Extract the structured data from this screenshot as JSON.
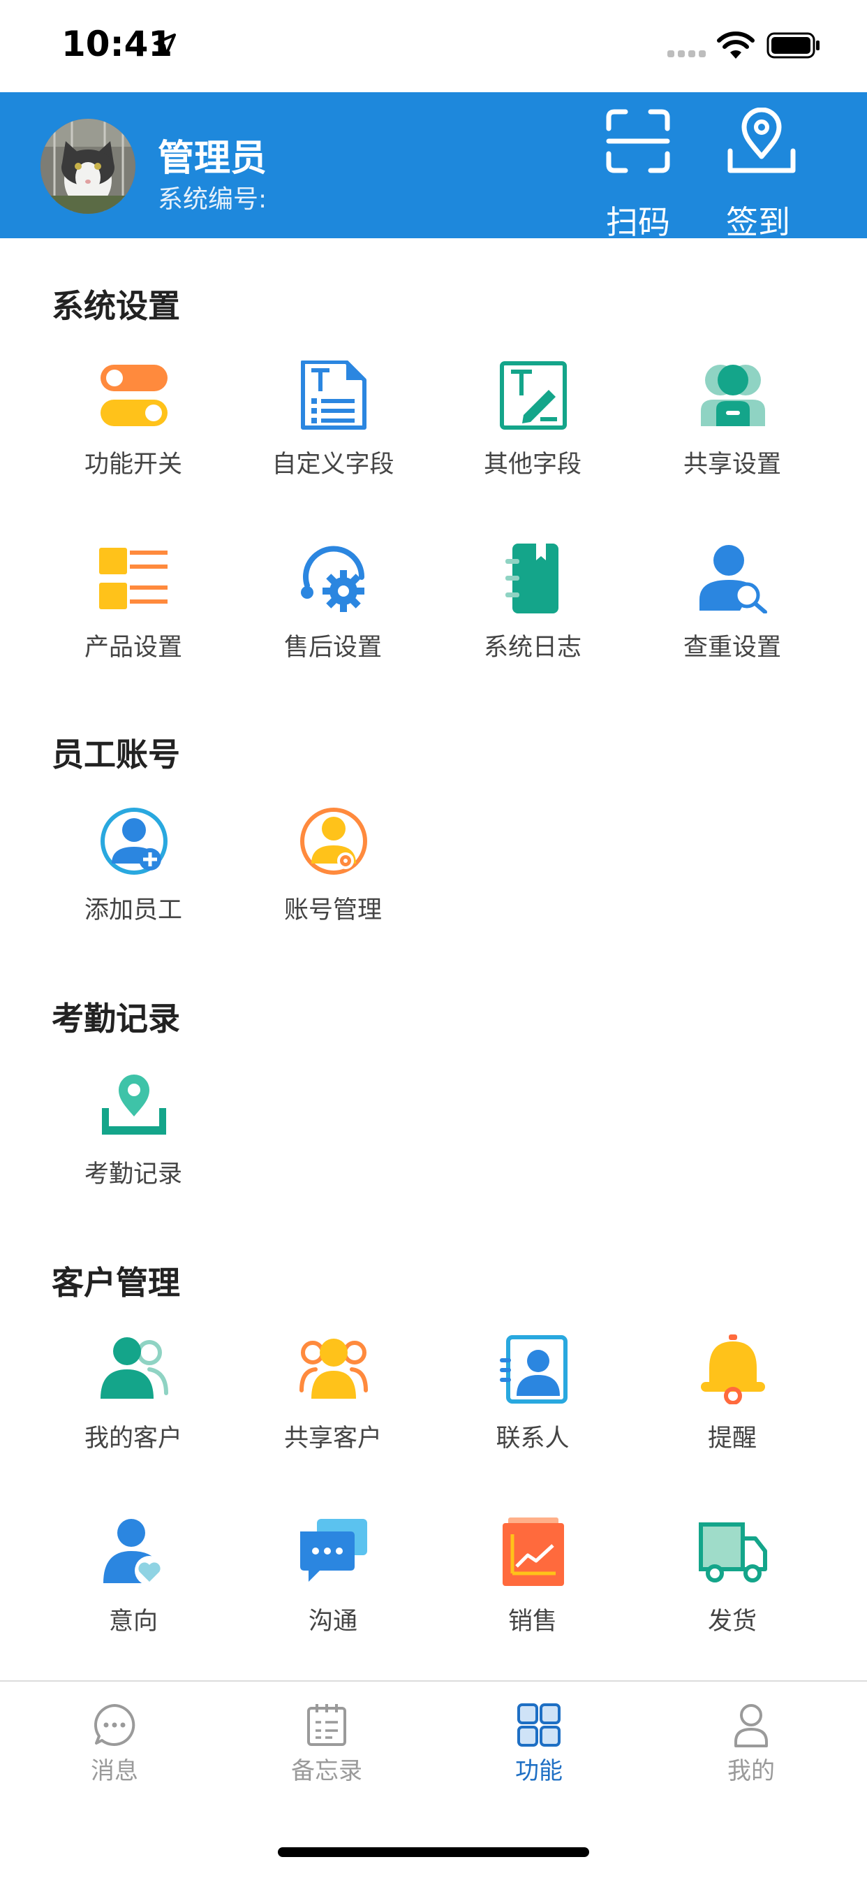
{
  "status_bar": {
    "time": "10:41"
  },
  "header": {
    "name": "管理员",
    "system_no_label": "系统编号:",
    "scan_label": "扫码",
    "checkin_label": "签到"
  },
  "sections": {
    "system": {
      "title": "系统设置",
      "items": [
        {
          "label": "功能开关",
          "icon": "toggle-switch-icon"
        },
        {
          "label": "自定义字段",
          "icon": "custom-field-icon"
        },
        {
          "label": "其他字段",
          "icon": "edit-field-icon"
        },
        {
          "label": "共享设置",
          "icon": "shared-users-icon"
        },
        {
          "label": "产品设置",
          "icon": "product-list-icon"
        },
        {
          "label": "售后设置",
          "icon": "support-gear-icon"
        },
        {
          "label": "系统日志",
          "icon": "notebook-icon"
        },
        {
          "label": "查重设置",
          "icon": "user-search-icon"
        }
      ]
    },
    "staff": {
      "title": "员工账号",
      "items": [
        {
          "label": "添加员工",
          "icon": "add-user-icon"
        },
        {
          "label": "账号管理",
          "icon": "user-gear-icon"
        }
      ]
    },
    "attendance": {
      "title": "考勤记录",
      "items": [
        {
          "label": "考勤记录",
          "icon": "location-checkin-icon"
        }
      ]
    },
    "customer": {
      "title": "客户管理",
      "items": [
        {
          "label": "我的客户",
          "icon": "my-customer-icon"
        },
        {
          "label": "共享客户",
          "icon": "shared-customer-icon"
        },
        {
          "label": "联系人",
          "icon": "contact-card-icon"
        },
        {
          "label": "提醒",
          "icon": "bell-icon"
        },
        {
          "label": "意向",
          "icon": "user-heart-icon"
        },
        {
          "label": "沟通",
          "icon": "chat-bubbles-icon"
        },
        {
          "label": "销售",
          "icon": "sales-chart-icon"
        },
        {
          "label": "发货",
          "icon": "delivery-truck-icon"
        }
      ]
    }
  },
  "tabbar": {
    "tabs": [
      {
        "label": "消息",
        "icon": "message-icon",
        "active": false
      },
      {
        "label": "备忘录",
        "icon": "memo-icon",
        "active": false
      },
      {
        "label": "功能",
        "icon": "grid-icon",
        "active": true
      },
      {
        "label": "我的",
        "icon": "profile-icon",
        "active": false
      }
    ]
  },
  "colors": {
    "header_blue": "#1e88dc",
    "active_tab": "#1e6fc4",
    "orange": "#ff8a3d",
    "yellow": "#ffc21a",
    "blue": "#2b86e0",
    "teal": "#14a58a"
  }
}
